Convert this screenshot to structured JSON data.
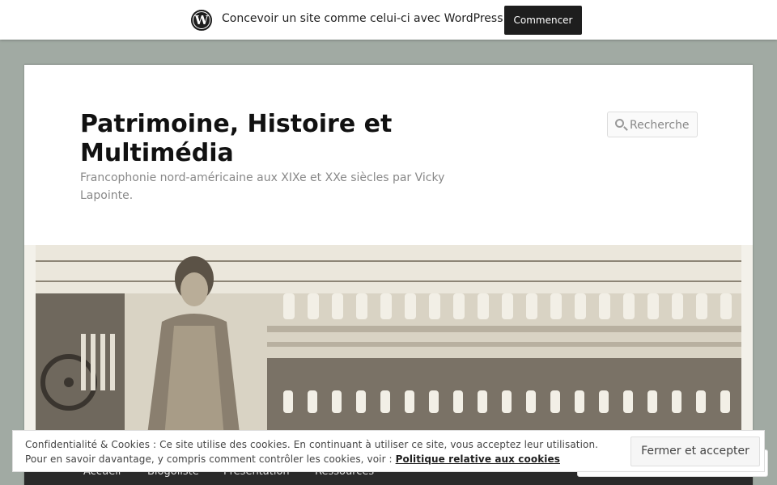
{
  "wpbar": {
    "logo_letter": "W",
    "text": "Concevoir un site comme celui-ci avec WordPress.com",
    "button": "Commencer"
  },
  "header": {
    "title": "Patrimoine, Histoire et Multimédia",
    "description": "Francophonie nord-américaine aux XIXe et XXe siècles par Vicky Lapointe.",
    "search_placeholder": "Recherche"
  },
  "nav": {
    "items": [
      "Accueil",
      "Blogoliste",
      "Présentation",
      "Ressources"
    ]
  },
  "cookie": {
    "line1": "Confidentialité & Cookies : Ce site utilise des cookies. En continuant à utiliser ce site, vous acceptez leur utilisation.",
    "line2_prefix": "Pour en savoir davantage, y compris comment contrôler les cookies, voir : ",
    "link": "Politique relative aux cookies",
    "button": "Fermer et accepter"
  },
  "colors": {
    "background": "#a1aaa3",
    "wp_button": "#1e1e1e",
    "nav": "#2a2a2a"
  }
}
